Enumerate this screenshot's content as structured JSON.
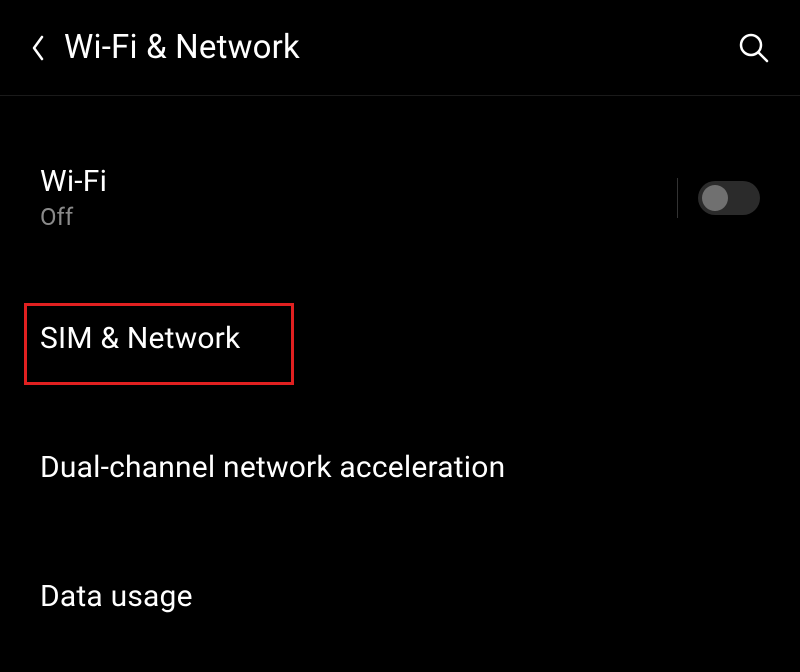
{
  "header": {
    "title": "Wi-Fi & Network"
  },
  "items": {
    "wifi": {
      "title": "Wi-Fi",
      "status": "Off",
      "toggle_on": false
    },
    "sim": {
      "title": "SIM & Network"
    },
    "dual": {
      "title": "Dual-channel network acceleration"
    },
    "data": {
      "title": "Data usage"
    }
  },
  "highlight": {
    "color": "#e02020"
  }
}
